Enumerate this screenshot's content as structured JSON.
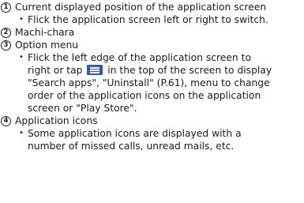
{
  "items": [
    {
      "number": "1",
      "title": "Current displayed position of the application screen",
      "bullets": [
        "Flick the application screen left or right to switch."
      ]
    },
    {
      "number": "2",
      "title": "Machi-chara",
      "bullets": []
    },
    {
      "number": "3",
      "title": "Option menu",
      "bullet_lines": [
        "Flick the left edge of the application screen to",
        "in the top of the screen to display",
        "\"Search apps\", \"Uninstall\" (P.61), menu to change",
        "order of the application icons on the application",
        "screen or \"Play Store\"."
      ],
      "bullet_prefix_before_icon": "right or tap",
      "icon": "menu-icon"
    },
    {
      "number": "4",
      "title": "Application icons",
      "bullet_lines": [
        "Some application icons are displayed with a",
        "number of missed calls, unread mails, etc."
      ]
    }
  ],
  "colors": {
    "text": "#1a1a1a",
    "menu_icon_bg": "#2f5fa8"
  }
}
